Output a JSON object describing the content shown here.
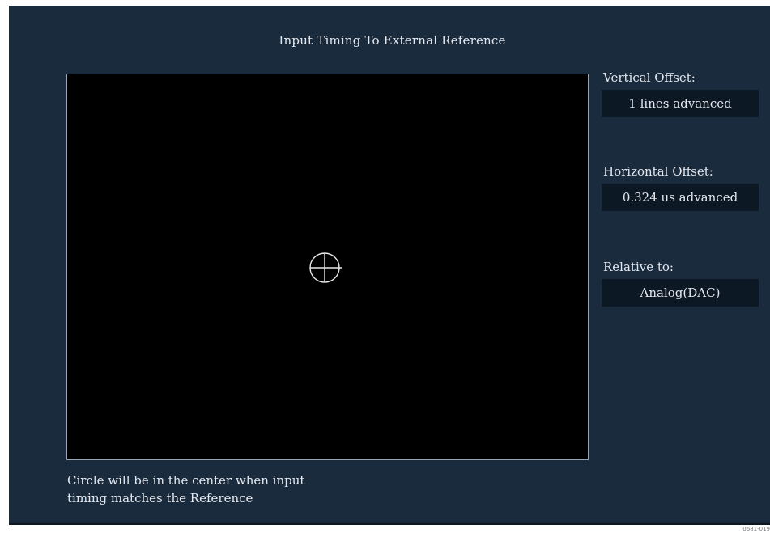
{
  "panel": {
    "title": "Input Timing To External Reference",
    "caption_line1": "Circle will be in the center when input",
    "caption_line2": "timing matches the Reference"
  },
  "readouts": {
    "vertical_offset_label": "Vertical Offset:",
    "vertical_offset_value": "1 lines advanced",
    "horizontal_offset_label": "Horizontal Offset:",
    "horizontal_offset_value": "0.324 us advanced",
    "relative_to_label": "Relative to:",
    "relative_to_value": "Analog(DAC)"
  },
  "figure_id": "0681-019",
  "colors": {
    "panel_background": "#1a2b3d",
    "plot_background": "#000000",
    "text": "#e4e8ee",
    "value_box": "#0d1825"
  }
}
